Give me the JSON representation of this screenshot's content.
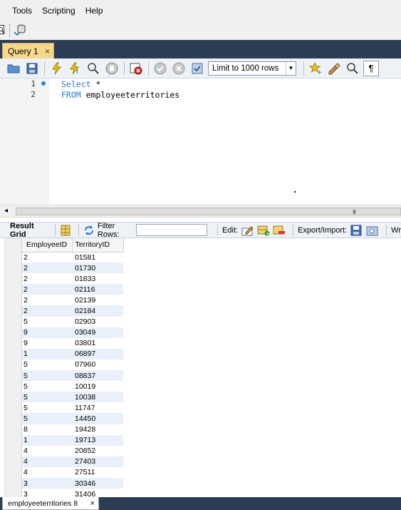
{
  "menu": [
    "Tools",
    "Scripting",
    "Help"
  ],
  "query_tab": {
    "label": "Query 1",
    "close": "×"
  },
  "toolbar": {
    "limit_value": "Limit to 1000 rows"
  },
  "editor": {
    "line_numbers": [
      "1",
      "2"
    ],
    "line1_kw": "Select",
    "line1_rest": " *",
    "line2_kw": "FROM",
    "line2_rest": " employeeterritories"
  },
  "scrollbar": {
    "left_arrow": "◂",
    "grip": "III"
  },
  "result_toolbar": {
    "result_grid": "Result Grid",
    "filter_rows": "Filter Rows:",
    "edit": "Edit:",
    "export_import": "Export/Import:",
    "wrap": "Wr"
  },
  "grid": {
    "columns": [
      "EmployeeID",
      "TerritoryID"
    ],
    "rows": [
      [
        "2",
        "01581"
      ],
      [
        "2",
        "01730"
      ],
      [
        "2",
        "01833"
      ],
      [
        "2",
        "02116"
      ],
      [
        "2",
        "02139"
      ],
      [
        "2",
        "02184"
      ],
      [
        "5",
        "02903"
      ],
      [
        "9",
        "03049"
      ],
      [
        "9",
        "03801"
      ],
      [
        "1",
        "06897"
      ],
      [
        "5",
        "07960"
      ],
      [
        "5",
        "08837"
      ],
      [
        "5",
        "10019"
      ],
      [
        "5",
        "10038"
      ],
      [
        "5",
        "11747"
      ],
      [
        "5",
        "14450"
      ],
      [
        "8",
        "19428"
      ],
      [
        "1",
        "19713"
      ],
      [
        "4",
        "20852"
      ],
      [
        "4",
        "27403"
      ],
      [
        "4",
        "27511"
      ],
      [
        "3",
        "30346"
      ],
      [
        "3",
        "31406"
      ]
    ]
  },
  "bottom_tab": {
    "label": "employeeterritories 8",
    "close": "×"
  }
}
